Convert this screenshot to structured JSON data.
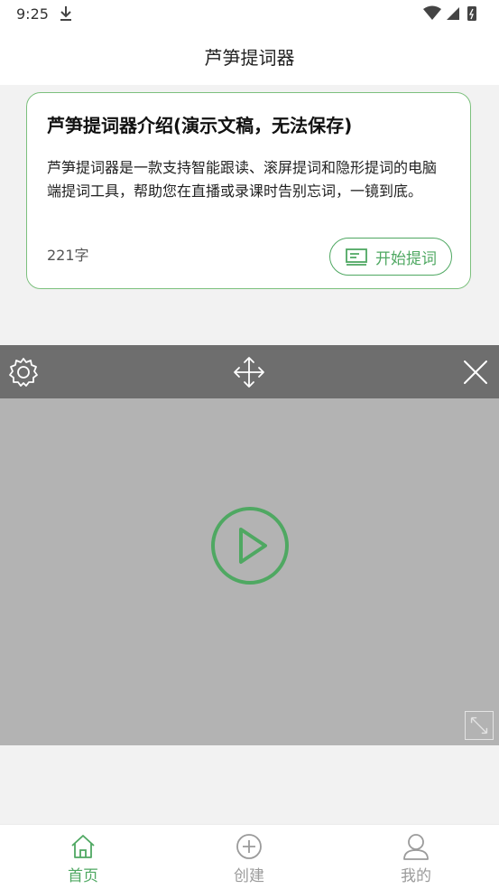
{
  "status_bar": {
    "time": "9:25"
  },
  "header": {
    "title": "芦笋提词器"
  },
  "card": {
    "title": "芦笋提词器介绍(演示文稿，无法保存)",
    "description": "芦笋提词器是一款支持智能跟读、滚屏提词和隐形提词的电脑端提词工具，帮助您在直播或录课时告别忘词，一镜到底。",
    "word_count": "221字",
    "start_label": "开始提词"
  },
  "bottom_nav": {
    "items": [
      {
        "label": "首页",
        "icon": "home-icon",
        "active": true
      },
      {
        "label": "创建",
        "icon": "plus-circle-icon",
        "active": false
      },
      {
        "label": "我的",
        "icon": "user-icon",
        "active": false
      }
    ]
  },
  "colors": {
    "accent": "#4fa862",
    "card_border": "#7cc07d",
    "toolbar_bg": "#6e6e6e",
    "prompter_bg": "#b3b3b3",
    "inactive": "#9b9b9b"
  }
}
